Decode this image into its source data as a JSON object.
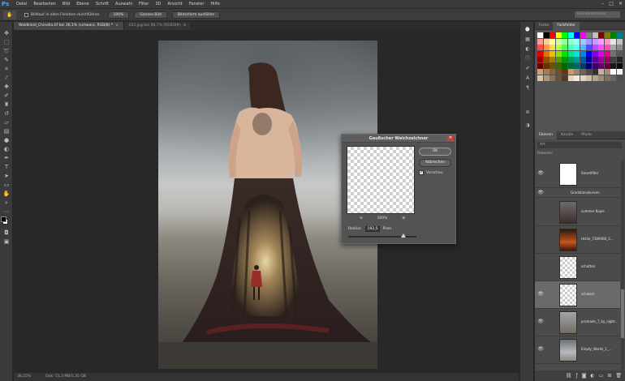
{
  "app": {
    "logo": "Ps"
  },
  "menu": [
    "Datei",
    "Bearbeiten",
    "Bild",
    "Ebene",
    "Schrift",
    "Auswahl",
    "Filter",
    "3D",
    "Ansicht",
    "Fenster",
    "Hilfe"
  ],
  "window_controls": [
    "–",
    "□",
    "✕"
  ],
  "options_bar": {
    "scroll_all_label": "Bildlauf in allen Fenstern durchführen",
    "zoom_100": "100%",
    "fit_screen": "Ganzes Bild",
    "fill_screen": "Bildschirm ausfüllen",
    "search_placeholder": "Grundelemente"
  },
  "tabs": [
    {
      "label": "Waldkleid_Chinella.tif bei 36,1% (schwarz, RGB/8) *",
      "active": true
    },
    {
      "label": "011.jpg bei 66,7% (RGB/8#)",
      "active": false
    }
  ],
  "status": {
    "zoom": "36,25%",
    "doc": "Dok: 51,3 MB/1,35 GB"
  },
  "dialog": {
    "title": "Gaußscher Weichzeichner",
    "ok": "OK",
    "cancel": "Abbrechen",
    "preview_label": "Vorschau",
    "preview_checked": true,
    "zoom_level": "100%",
    "radius_label": "Radius:",
    "radius_value": "192,5",
    "radius_unit": "Pixel",
    "radius_fraction": 0.81
  },
  "panels": {
    "color_tabs": [
      "Farbe",
      "Farbfelder"
    ],
    "layers_tabs": [
      "Ebenen",
      "Kanäle",
      "Pfade"
    ],
    "layers_filter": "Art",
    "layers_mode": "Fixieren:",
    "layers": [
      {
        "name": "Smartfilter",
        "thumb": "white",
        "visible": true,
        "selected": false
      },
      {
        "name": "Gradationskurven",
        "thumb": "none",
        "visible": true,
        "selected": false
      },
      {
        "name": "summer Kopie",
        "thumb": "photo",
        "visible": false,
        "selected": false
      },
      {
        "name": "Hstile_7389460_3...",
        "thumb": "fire",
        "visible": false,
        "selected": false
      },
      {
        "name": "schatten",
        "thumb": "checker",
        "visible": false,
        "selected": false
      },
      {
        "name": "schwarz",
        "thumb": "checker",
        "visible": true,
        "selected": true
      },
      {
        "name": "promade_7_by_night...",
        "thumb": "landscape",
        "visible": true,
        "selected": false
      },
      {
        "name": "Empty_Words_1_...",
        "thumb": "sky",
        "visible": true,
        "selected": false
      }
    ]
  },
  "swatch_colors": [
    "#ffffff",
    "#000000",
    "#ff0000",
    "#ffff00",
    "#00ff00",
    "#00ffff",
    "#0000ff",
    "#ff00ff",
    "#808080",
    "#c0c0c0",
    "#800000",
    "#808000",
    "#008000",
    "#008080",
    "#ff9999",
    "#ffcc99",
    "#ffff99",
    "#ccff99",
    "#99ff99",
    "#99ffcc",
    "#99ffff",
    "#99ccff",
    "#9999ff",
    "#cc99ff",
    "#ff99ff",
    "#ff99cc",
    "#e6e6e6",
    "#bfbfbf",
    "#ff4d4d",
    "#ff944d",
    "#ffdb4d",
    "#b8ff4d",
    "#4dff4d",
    "#4dffb8",
    "#4dffff",
    "#4db8ff",
    "#4d4dff",
    "#b84dff",
    "#ff4dff",
    "#ff4db8",
    "#a6a6a6",
    "#8c8c8c",
    "#e60000",
    "#e67300",
    "#e6c200",
    "#8ae600",
    "#00e600",
    "#00e68a",
    "#00e6e6",
    "#008ae6",
    "#0000e6",
    "#8a00e6",
    "#e600e6",
    "#e6008a",
    "#737373",
    "#595959",
    "#990000",
    "#994d00",
    "#998000",
    "#5c9900",
    "#009900",
    "#00995c",
    "#009999",
    "#005c99",
    "#000099",
    "#5c0099",
    "#990099",
    "#99005c",
    "#404040",
    "#262626",
    "#660000",
    "#663300",
    "#665500",
    "#3d6600",
    "#006600",
    "#00663d",
    "#006666",
    "#003d66",
    "#000066",
    "#3d0066",
    "#660066",
    "#66003d",
    "#1a1a1a",
    "#0d0d0d",
    "#c8a27a",
    "#a67c52",
    "#8c6239",
    "#754c24",
    "#603913",
    "#c69c6d",
    "#998675",
    "#736357",
    "#534741",
    "#362f2d",
    "#c7b299",
    "#a3907a",
    "#ffffff",
    "#f2f2f2",
    "#d9c6a5",
    "#b09673",
    "#8a7152",
    "#6b5337",
    "#4e3b24",
    "#e8d6b8",
    "#f4eadb",
    "#e0d4c0",
    "#ccbfa8",
    "#b3a58c",
    "#9a8c73",
    "#80735c",
    "#666666",
    "#4d4d4d"
  ]
}
